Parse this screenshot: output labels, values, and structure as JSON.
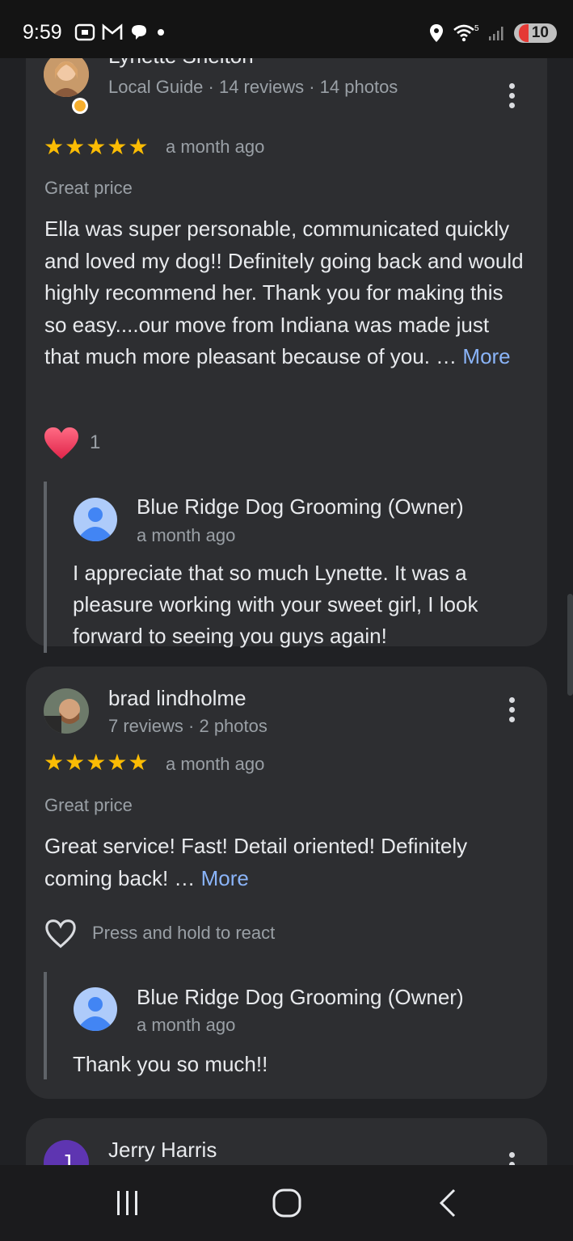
{
  "status_bar": {
    "time": "9:59",
    "battery": "10"
  },
  "reviews": [
    {
      "name": "Lynette Shelton",
      "meta": "Local Guide · 14 reviews · 14 photos",
      "date": "a month ago",
      "rating": 5,
      "tag": "Great price",
      "text": "Ella was super personable, communicated quickly and loved my dog!! Definitely going back and would highly recommend her. Thank you for making this so easy....our move from Indiana was made just that much more pleasant because of you. … ",
      "more": "More",
      "reaction_count": "1",
      "owner_reply": {
        "name": "Blue Ridge Dog Grooming (Owner)",
        "date": "a month ago",
        "text": "I appreciate that so much Lynette. It was a pleasure working with your sweet girl, I look forward to seeing you guys again!"
      }
    },
    {
      "name": "brad lindholme",
      "meta": "7 reviews · 2 photos",
      "date": "a month ago",
      "rating": 5,
      "tag": "Great price",
      "text": "Great service! Fast! Detail oriented! Definitely coming back! … ",
      "more": "More",
      "react_hint": "Press and hold to react",
      "owner_reply": {
        "name": "Blue Ridge Dog Grooming (Owner)",
        "date": "a month ago",
        "text": "Thank you so much!!"
      }
    },
    {
      "name": "Jerry Harris",
      "avatar_letter": "J"
    }
  ],
  "colors": {
    "background": "#202124",
    "card": "#2d2e31",
    "star": "#fbbc04",
    "link": "#8ab4f8",
    "heart": "#f0425f",
    "avatar_purple": "#5e35b1"
  }
}
